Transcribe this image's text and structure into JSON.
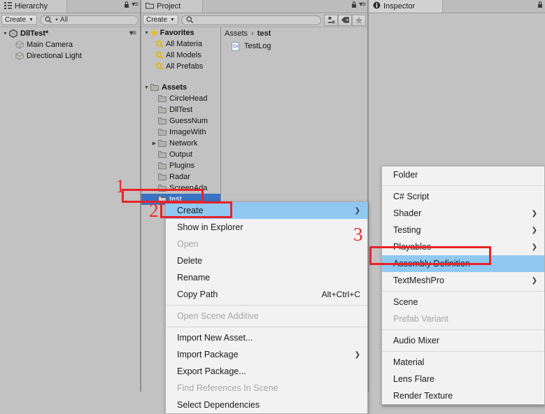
{
  "hierarchy": {
    "tab_label": "Hierarchy",
    "tab_icon": "hierarchy-icon",
    "create_label": "Create",
    "search_value": "All",
    "search_icon": "search-icon",
    "scene_name": "DllTest*",
    "objects": [
      {
        "label": "Main Camera",
        "icon": "gameobject-cube-icon"
      },
      {
        "label": "Directional Light",
        "icon": "gameobject-cube-icon"
      }
    ]
  },
  "project": {
    "tab_label": "Project",
    "tab_icon": "folder-icon",
    "create_label": "Create",
    "search_placeholder": "",
    "search_icon": "search-icon",
    "toolbar_icons": [
      "avatar-filter-icon",
      "label-tag-icon",
      "favorite-star-icon"
    ],
    "favorites": {
      "label": "Favorites",
      "icon": "star-icon",
      "items": [
        {
          "label": "All Materia",
          "icon": "search-magnifier-icon"
        },
        {
          "label": "All Models",
          "icon": "search-magnifier-icon"
        },
        {
          "label": "All Prefabs",
          "icon": "search-magnifier-icon"
        }
      ]
    },
    "assets": {
      "label": "Assets",
      "items": [
        {
          "label": "CircleHead",
          "expandable": false,
          "selected": false
        },
        {
          "label": "DllTest",
          "expandable": false,
          "selected": false
        },
        {
          "label": "GuessNum",
          "expandable": false,
          "selected": false
        },
        {
          "label": "ImageWith",
          "expandable": false,
          "selected": false
        },
        {
          "label": "Network",
          "expandable": true,
          "selected": false
        },
        {
          "label": "Output",
          "expandable": false,
          "selected": false
        },
        {
          "label": "Plugins",
          "expandable": false,
          "selected": false
        },
        {
          "label": "Radar",
          "expandable": false,
          "selected": false
        },
        {
          "label": "ScreenAda",
          "expandable": false,
          "selected": false
        },
        {
          "label": "test",
          "expandable": false,
          "selected": true
        }
      ]
    },
    "breadcrumb": {
      "root": "Assets",
      "separator": "›",
      "current": "test"
    },
    "content_items": [
      {
        "label": "TestLog",
        "icon": "csharp-script-icon"
      }
    ]
  },
  "inspector": {
    "tab_label": "Inspector",
    "tab_icon": "info-icon"
  },
  "context_menu": {
    "items": [
      {
        "label": "Create",
        "highlighted": true,
        "disabled": false,
        "submenu": true,
        "shortcut": ""
      },
      {
        "label": "Show in Explorer",
        "highlighted": false,
        "disabled": false,
        "submenu": false,
        "shortcut": ""
      },
      {
        "label": "Open",
        "highlighted": false,
        "disabled": true,
        "submenu": false,
        "shortcut": ""
      },
      {
        "label": "Delete",
        "highlighted": false,
        "disabled": false,
        "submenu": false,
        "shortcut": ""
      },
      {
        "label": "Rename",
        "highlighted": false,
        "disabled": false,
        "submenu": false,
        "shortcut": ""
      },
      {
        "label": "Copy Path",
        "highlighted": false,
        "disabled": false,
        "submenu": false,
        "shortcut": "Alt+Ctrl+C"
      },
      {
        "separator": true
      },
      {
        "label": "Open Scene Additive",
        "highlighted": false,
        "disabled": true,
        "submenu": false,
        "shortcut": ""
      },
      {
        "separator": true
      },
      {
        "label": "Import New Asset...",
        "highlighted": false,
        "disabled": false,
        "submenu": false,
        "shortcut": ""
      },
      {
        "label": "Import Package",
        "highlighted": false,
        "disabled": false,
        "submenu": true,
        "shortcut": ""
      },
      {
        "label": "Export Package...",
        "highlighted": false,
        "disabled": false,
        "submenu": false,
        "shortcut": ""
      },
      {
        "label": "Find References In Scene",
        "highlighted": false,
        "disabled": true,
        "submenu": false,
        "shortcut": ""
      },
      {
        "label": "Select Dependencies",
        "highlighted": false,
        "disabled": false,
        "submenu": false,
        "shortcut": ""
      }
    ]
  },
  "create_submenu": {
    "items": [
      {
        "label": "Folder",
        "highlighted": false,
        "disabled": false,
        "submenu": false
      },
      {
        "separator": true
      },
      {
        "label": "C# Script",
        "highlighted": false,
        "disabled": false,
        "submenu": false
      },
      {
        "label": "Shader",
        "highlighted": false,
        "disabled": false,
        "submenu": true
      },
      {
        "label": "Testing",
        "highlighted": false,
        "disabled": false,
        "submenu": true
      },
      {
        "label": "Playables",
        "highlighted": false,
        "disabled": false,
        "submenu": true
      },
      {
        "label": "Assembly Definition",
        "highlighted": true,
        "disabled": false,
        "submenu": false
      },
      {
        "label": "TextMeshPro",
        "highlighted": false,
        "disabled": false,
        "submenu": true
      },
      {
        "separator": true
      },
      {
        "label": "Scene",
        "highlighted": false,
        "disabled": false,
        "submenu": false
      },
      {
        "label": "Prefab Variant",
        "highlighted": false,
        "disabled": true,
        "submenu": false
      },
      {
        "separator": true
      },
      {
        "label": "Audio Mixer",
        "highlighted": false,
        "disabled": false,
        "submenu": false
      },
      {
        "separator": true
      },
      {
        "label": "Material",
        "highlighted": false,
        "disabled": false,
        "submenu": false
      },
      {
        "label": "Lens Flare",
        "highlighted": false,
        "disabled": false,
        "submenu": false
      },
      {
        "label": "Render Texture",
        "highlighted": false,
        "disabled": false,
        "submenu": false
      }
    ]
  },
  "annotations": {
    "accent_color": "#ee2a2f",
    "steps": [
      {
        "number": "1",
        "target": "test-folder-row"
      },
      {
        "number": "2",
        "target": "create-menu-item"
      },
      {
        "number": "3",
        "target": "assembly-definition-menu-item"
      }
    ]
  },
  "colors": {
    "panel_bg": "#c2c2c2",
    "selection_blue": "#3a72c4",
    "menu_highlight": "#8fc9f2",
    "annotation_red": "#ee2a2f"
  }
}
